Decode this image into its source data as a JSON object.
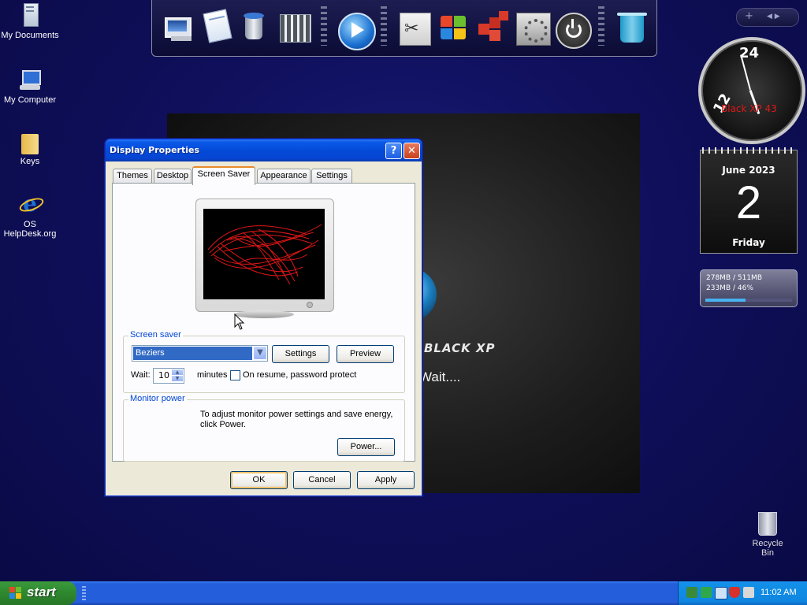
{
  "desktop": {
    "icons": [
      {
        "label": "My Documents",
        "icon": "my-documents-icon"
      },
      {
        "label": "My Computer",
        "icon": "my-computer-icon"
      },
      {
        "label": "Keys",
        "icon": "folder-icon"
      },
      {
        "label": "OS HelpDesk.org",
        "icon": "internet-explorer-icon"
      }
    ],
    "recycle_bin_label": "Recycle Bin"
  },
  "wallpaper": {
    "brand_text": "BLACK XP",
    "wait_text": "Wait...."
  },
  "dock": {
    "items": [
      "display-settings-icon",
      "notepad-icon",
      "paint-bucket-icon",
      "calculator-icon",
      "media-player-icon",
      "scissors-icon",
      "windows-logo-icon",
      "cubes-icon",
      "control-panel-icon",
      "power-icon",
      "recycle-bin-icon"
    ]
  },
  "gadgets": {
    "clock_label": "Black XP 43",
    "clock_numerals": [
      "24",
      "12"
    ],
    "calendar": {
      "month_year": "June 2023",
      "day": "2",
      "weekday": "Friday"
    },
    "memory": {
      "line1": "278MB / 511MB",
      "line2": "233MB / 46%",
      "usage_fraction": 0.46
    },
    "mini_bar_plus": "+",
    "mini_bar_arrows": "◀ ▶"
  },
  "dialog": {
    "title": "Display Properties",
    "help_glyph": "?",
    "close_glyph": "✕",
    "tabs": [
      "Themes",
      "Desktop",
      "Screen Saver",
      "Appearance",
      "Settings"
    ],
    "active_tab": "Screen Saver",
    "screen_saver_group_label": "Screen saver",
    "screen_saver_value": "Beziers",
    "settings_button": "Settings",
    "preview_button": "Preview",
    "wait_label": "Wait:",
    "wait_value": "10",
    "minutes_label": "minutes",
    "password_protect_label": "On resume, password protect",
    "password_protect_checked": false,
    "monitor_power_group_label": "Monitor power",
    "monitor_power_text": "To adjust monitor power settings and save energy, click Power.",
    "power_button": "Power...",
    "ok_button": "OK",
    "cancel_button": "Cancel",
    "apply_button": "Apply"
  },
  "taskbar": {
    "start_label": "start",
    "clock": "11:02 AM",
    "tray_icons": [
      "network-icon",
      "green-s-icon",
      "monitor-icon",
      "security-shield-icon",
      "speaker-icon"
    ]
  }
}
